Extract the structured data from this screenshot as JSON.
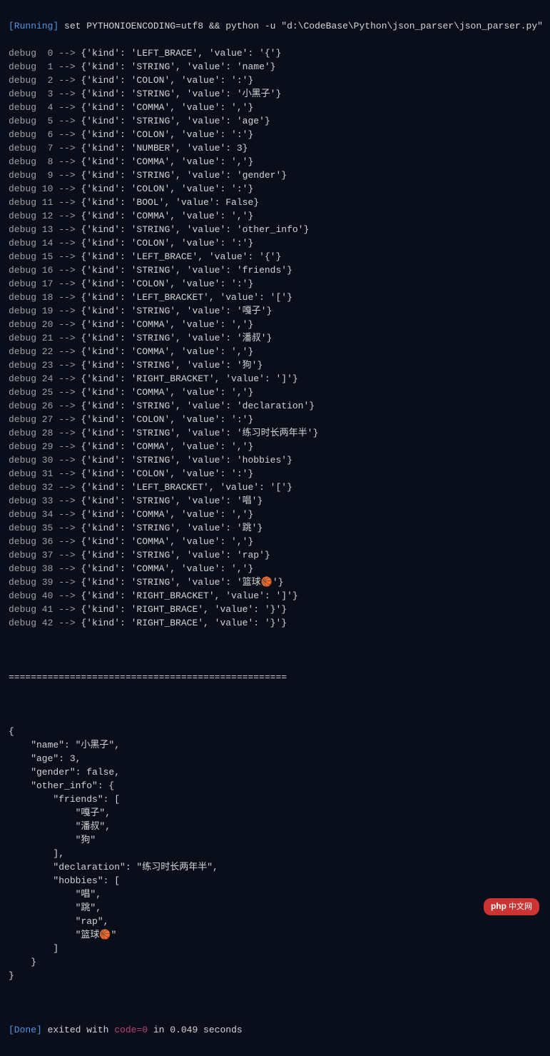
{
  "header": {
    "status": "[Running]",
    "command": " set PYTHONIOENCODING=utf8 && python -u \"d:\\CodeBase\\Python\\json_parser\\json_parser.py\""
  },
  "debug_lines": [
    {
      "prefix": "debug  0 --> ",
      "content": "{'kind': 'LEFT_BRACE', 'value': '{'}"
    },
    {
      "prefix": "debug  1 --> ",
      "content": "{'kind': 'STRING', 'value': 'name'}"
    },
    {
      "prefix": "debug  2 --> ",
      "content": "{'kind': 'COLON', 'value': ':'}"
    },
    {
      "prefix": "debug  3 --> ",
      "content": "{'kind': 'STRING', 'value': '小黑子'}"
    },
    {
      "prefix": "debug  4 --> ",
      "content": "{'kind': 'COMMA', 'value': ','}"
    },
    {
      "prefix": "debug  5 --> ",
      "content": "{'kind': 'STRING', 'value': 'age'}"
    },
    {
      "prefix": "debug  6 --> ",
      "content": "{'kind': 'COLON', 'value': ':'}"
    },
    {
      "prefix": "debug  7 --> ",
      "content": "{'kind': 'NUMBER', 'value': 3}"
    },
    {
      "prefix": "debug  8 --> ",
      "content": "{'kind': 'COMMA', 'value': ','}"
    },
    {
      "prefix": "debug  9 --> ",
      "content": "{'kind': 'STRING', 'value': 'gender'}"
    },
    {
      "prefix": "debug 10 --> ",
      "content": "{'kind': 'COLON', 'value': ':'}"
    },
    {
      "prefix": "debug 11 --> ",
      "content": "{'kind': 'BOOL', 'value': False}"
    },
    {
      "prefix": "debug 12 --> ",
      "content": "{'kind': 'COMMA', 'value': ','}"
    },
    {
      "prefix": "debug 13 --> ",
      "content": "{'kind': 'STRING', 'value': 'other_info'}"
    },
    {
      "prefix": "debug 14 --> ",
      "content": "{'kind': 'COLON', 'value': ':'}"
    },
    {
      "prefix": "debug 15 --> ",
      "content": "{'kind': 'LEFT_BRACE', 'value': '{'}"
    },
    {
      "prefix": "debug 16 --> ",
      "content": "{'kind': 'STRING', 'value': 'friends'}"
    },
    {
      "prefix": "debug 17 --> ",
      "content": "{'kind': 'COLON', 'value': ':'}"
    },
    {
      "prefix": "debug 18 --> ",
      "content": "{'kind': 'LEFT_BRACKET', 'value': '['}"
    },
    {
      "prefix": "debug 19 --> ",
      "content": "{'kind': 'STRING', 'value': '嘎子'}"
    },
    {
      "prefix": "debug 20 --> ",
      "content": "{'kind': 'COMMA', 'value': ','}"
    },
    {
      "prefix": "debug 21 --> ",
      "content": "{'kind': 'STRING', 'value': '潘叔'}"
    },
    {
      "prefix": "debug 22 --> ",
      "content": "{'kind': 'COMMA', 'value': ','}"
    },
    {
      "prefix": "debug 23 --> ",
      "content": "{'kind': 'STRING', 'value': '狗'}"
    },
    {
      "prefix": "debug 24 --> ",
      "content": "{'kind': 'RIGHT_BRACKET', 'value': ']'}"
    },
    {
      "prefix": "debug 25 --> ",
      "content": "{'kind': 'COMMA', 'value': ','}"
    },
    {
      "prefix": "debug 26 --> ",
      "content": "{'kind': 'STRING', 'value': 'declaration'}"
    },
    {
      "prefix": "debug 27 --> ",
      "content": "{'kind': 'COLON', 'value': ':'}"
    },
    {
      "prefix": "debug 28 --> ",
      "content": "{'kind': 'STRING', 'value': '练习时长两年半'}"
    },
    {
      "prefix": "debug 29 --> ",
      "content": "{'kind': 'COMMA', 'value': ','}"
    },
    {
      "prefix": "debug 30 --> ",
      "content": "{'kind': 'STRING', 'value': 'hobbies'}"
    },
    {
      "prefix": "debug 31 --> ",
      "content": "{'kind': 'COLON', 'value': ':'}"
    },
    {
      "prefix": "debug 32 --> ",
      "content": "{'kind': 'LEFT_BRACKET', 'value': '['}"
    },
    {
      "prefix": "debug 33 --> ",
      "content": "{'kind': 'STRING', 'value': '唱'}"
    },
    {
      "prefix": "debug 34 --> ",
      "content": "{'kind': 'COMMA', 'value': ','}"
    },
    {
      "prefix": "debug 35 --> ",
      "content": "{'kind': 'STRING', 'value': '跳'}"
    },
    {
      "prefix": "debug 36 --> ",
      "content": "{'kind': 'COMMA', 'value': ','}"
    },
    {
      "prefix": "debug 37 --> ",
      "content": "{'kind': 'STRING', 'value': 'rap'}"
    },
    {
      "prefix": "debug 38 --> ",
      "content": "{'kind': 'COMMA', 'value': ','}"
    },
    {
      "prefix": "debug 39 --> ",
      "content": "{'kind': 'STRING', 'value': '篮球🏀'}"
    },
    {
      "prefix": "debug 40 --> ",
      "content": "{'kind': 'RIGHT_BRACKET', 'value': ']'}"
    },
    {
      "prefix": "debug 41 --> ",
      "content": "{'kind': 'RIGHT_BRACE', 'value': '}'}"
    },
    {
      "prefix": "debug 42 --> ",
      "content": "{'kind': 'RIGHT_BRACE', 'value': '}'}"
    }
  ],
  "separator": "==================================================",
  "json_output": [
    "{",
    "    \"name\": \"小黑子\",",
    "    \"age\": 3,",
    "    \"gender\": false,",
    "    \"other_info\": {",
    "        \"friends\": [",
    "            \"嘎子\",",
    "            \"潘叔\",",
    "            \"狗\"",
    "        ],",
    "        \"declaration\": \"练习时长两年半\",",
    "        \"hobbies\": [",
    "            \"唱\",",
    "            \"跳\",",
    "            \"rap\",",
    "            \"篮球🏀\"",
    "        ]",
    "    }",
    "}"
  ],
  "footer": {
    "status": "[Done]",
    "exit_prefix": " exited with ",
    "exit_code": "code=0",
    "exit_suffix": " in 0.049 seconds"
  },
  "watermark": {
    "prefix": "php",
    "suffix": " 中文网"
  }
}
